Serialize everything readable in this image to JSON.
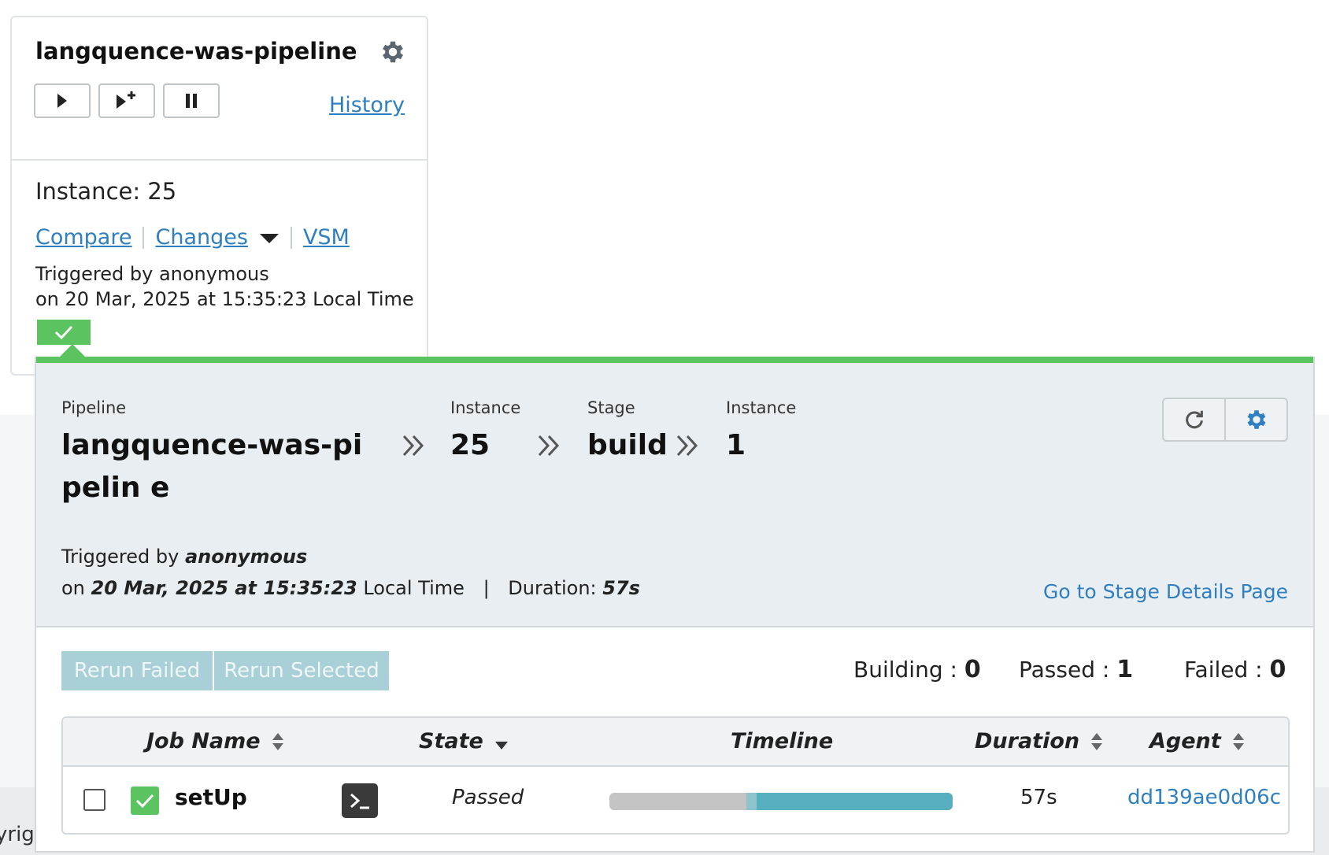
{
  "pipeline_card": {
    "title": "langquence-was-pipeline",
    "history_label": "History",
    "instance_text": "Instance: 25",
    "links": {
      "compare": "Compare",
      "changes": "Changes",
      "vsm": "VSM"
    },
    "triggered_line1": "Triggered by anonymous",
    "triggered_line2": "on 20 Mar, 2025 at 15:35:23 Local Time",
    "icons": [
      "gear-icon",
      "play-icon",
      "play-with-options-icon",
      "pause-icon",
      "chevron-down-icon",
      "check-icon"
    ]
  },
  "stage_panel": {
    "breadcrumb": {
      "pipeline_label": "Pipeline",
      "pipeline_value": "langquence-was-pipelin e",
      "instance_label": "Instance",
      "instance_value": "25",
      "stage_label": "Stage",
      "stage_value": "build",
      "stage_instance_label": "Instance",
      "stage_instance_value": "1"
    },
    "triggered_prefix": "Triggered by ",
    "triggered_user": "anonymous",
    "on_prefix": "on ",
    "date": "20 Mar, 2025 at 15:35:23",
    "local_time": " Local Time",
    "separator": "|",
    "duration_label": "Duration: ",
    "duration_value": "57s",
    "goto_link": "Go to Stage Details Page",
    "rerun_failed": "Rerun Failed",
    "rerun_selected": "Rerun Selected",
    "counts": {
      "building_label": "Building : ",
      "building": "0",
      "passed_label": "Passed : ",
      "passed": "1",
      "failed_label": "Failed : ",
      "failed": "0"
    },
    "table": {
      "headers": {
        "job_name": "Job Name",
        "state": "State",
        "timeline": "Timeline",
        "duration": "Duration",
        "agent": "Agent"
      },
      "rows": [
        {
          "name": "setUp",
          "state": "Passed",
          "duration": "57s",
          "agent": "dd139ae0d06c",
          "timeline_wait_fraction": 0.4,
          "timeline_prep_fraction": 0.03,
          "timeline_build_fraction": 0.57
        }
      ]
    },
    "colors": {
      "passed": "#5bc35f",
      "link": "#2f7fc1",
      "timeline_build": "#56aebf",
      "timeline_wait": "#c4c4c4"
    }
  },
  "footer": {
    "copyright_fragment": "yrigh"
  }
}
